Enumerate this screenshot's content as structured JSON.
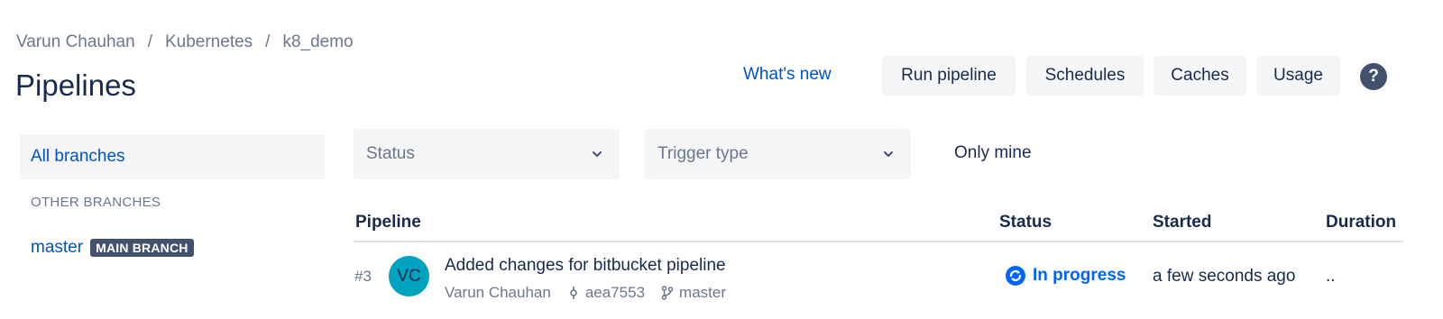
{
  "breadcrumb": {
    "items": [
      "Varun Chauhan",
      "Kubernetes",
      "k8_demo"
    ],
    "separator": "/"
  },
  "page": {
    "title": "Pipelines"
  },
  "header_actions": {
    "whats_new": "What's new",
    "run_pipeline": "Run pipeline",
    "schedules": "Schedules",
    "caches": "Caches",
    "usage": "Usage",
    "help": "?"
  },
  "sidebar": {
    "all_branches": "All branches",
    "section_label": "OTHER BRANCHES",
    "branches": [
      {
        "name": "master",
        "badge": "MAIN BRANCH"
      }
    ]
  },
  "filters": {
    "status_placeholder": "Status",
    "trigger_placeholder": "Trigger type",
    "only_mine": "Only mine"
  },
  "table": {
    "columns": [
      "Pipeline",
      "Status",
      "Started",
      "Duration"
    ],
    "rows": [
      {
        "number": "#3",
        "avatar_initials": "VC",
        "message": "Added changes for bitbucket pipeline",
        "author": "Varun Chauhan",
        "commit": "aea7553",
        "branch": "master",
        "status": "In progress",
        "started": "a few seconds ago",
        "duration": ".."
      }
    ]
  },
  "colors": {
    "link": "#0052cc",
    "status_in_progress": "#0065ff",
    "avatar_bg": "#00a3bf",
    "badge_bg": "#42526e"
  },
  "icons": {
    "select_chevron": "chevron-down-icon",
    "commit": "commit-icon",
    "branch": "branch-icon",
    "status": "in-progress-icon",
    "help": "help-icon"
  }
}
